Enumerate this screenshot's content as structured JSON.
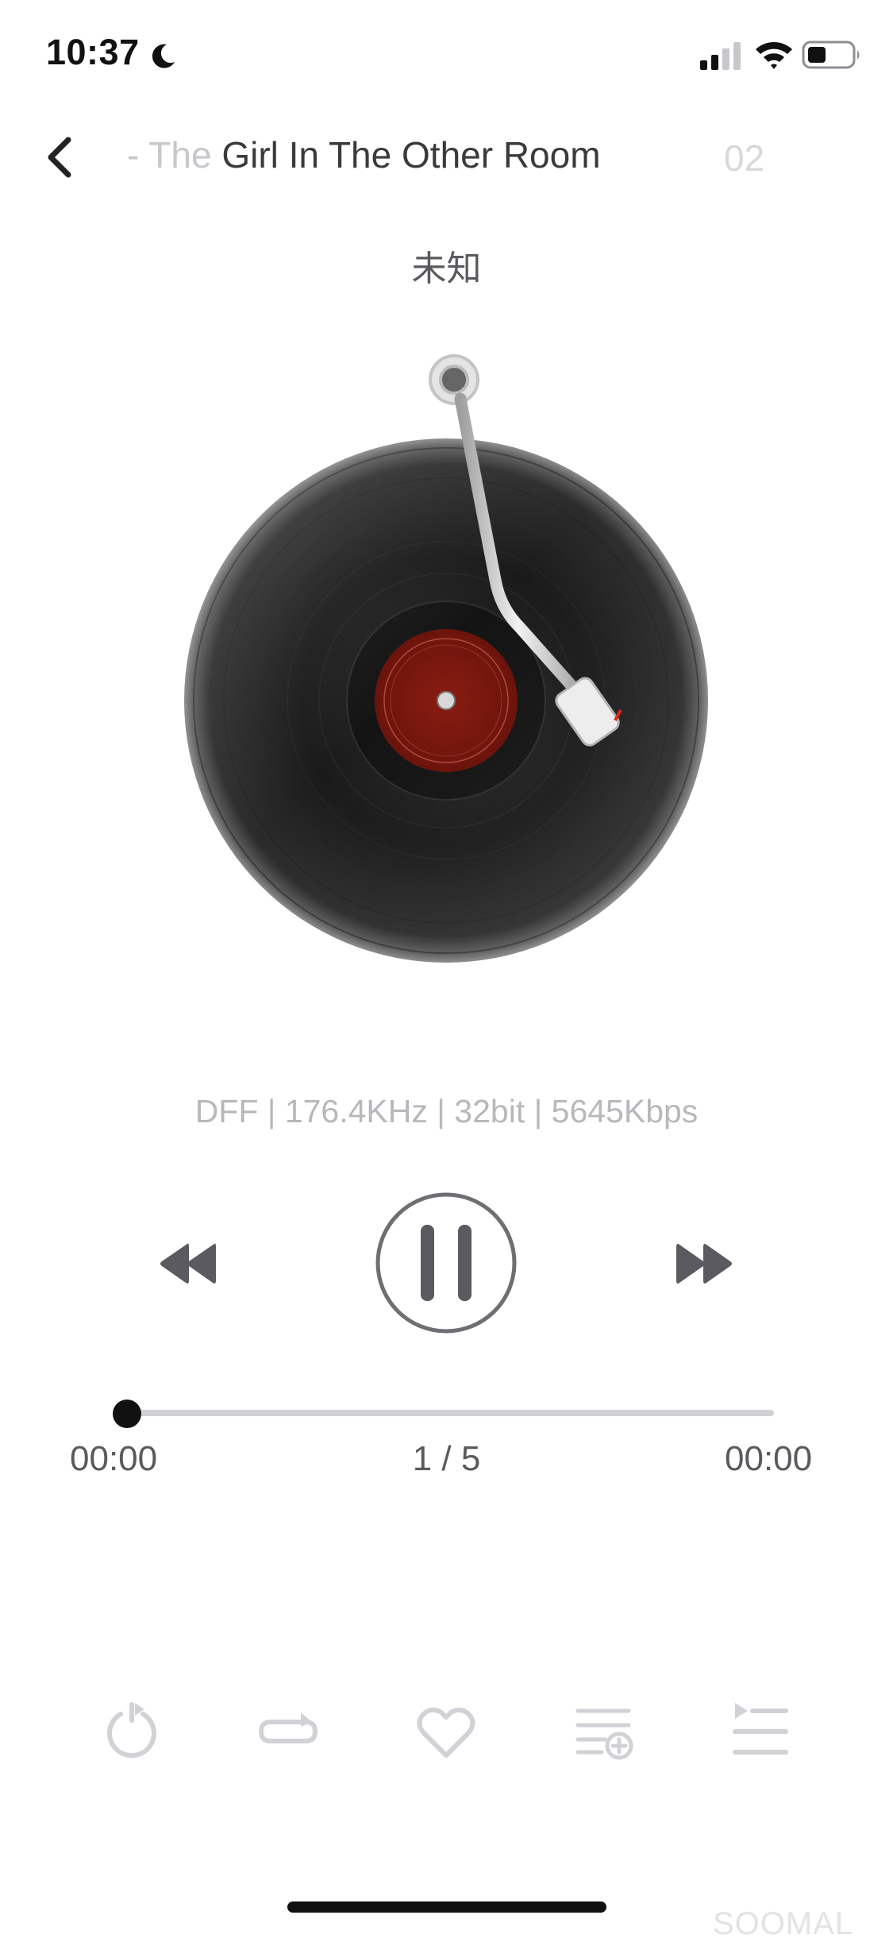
{
  "status_bar": {
    "time": "10:37",
    "icons": [
      "moon-icon",
      "cellular-signal-icon",
      "wifi-icon",
      "battery-icon"
    ]
  },
  "header": {
    "back_icon": "chevron-left-icon",
    "title_prefix": "- The",
    "title_main": " Girl In The Other Room",
    "title_next": "02",
    "artist": "未知"
  },
  "player": {
    "artwork": "vinyl-record-turntable",
    "label_color": "#7a1a10",
    "format_info": "DFF | 176.4KHz | 32bit | 5645Kbps",
    "controls": {
      "prev_icon": "rewind-icon",
      "play_pause_icon": "pause-icon",
      "next_icon": "fast-forward-icon"
    },
    "progress": {
      "elapsed": "00:00",
      "track_index": "1 / 5",
      "duration": "00:00",
      "fraction": 0
    }
  },
  "toolbar": {
    "items": [
      "sleep-timer-icon",
      "repeat-icon",
      "heart-icon",
      "add-to-playlist-icon",
      "play-queue-icon"
    ]
  },
  "watermark": "SOOMAL"
}
